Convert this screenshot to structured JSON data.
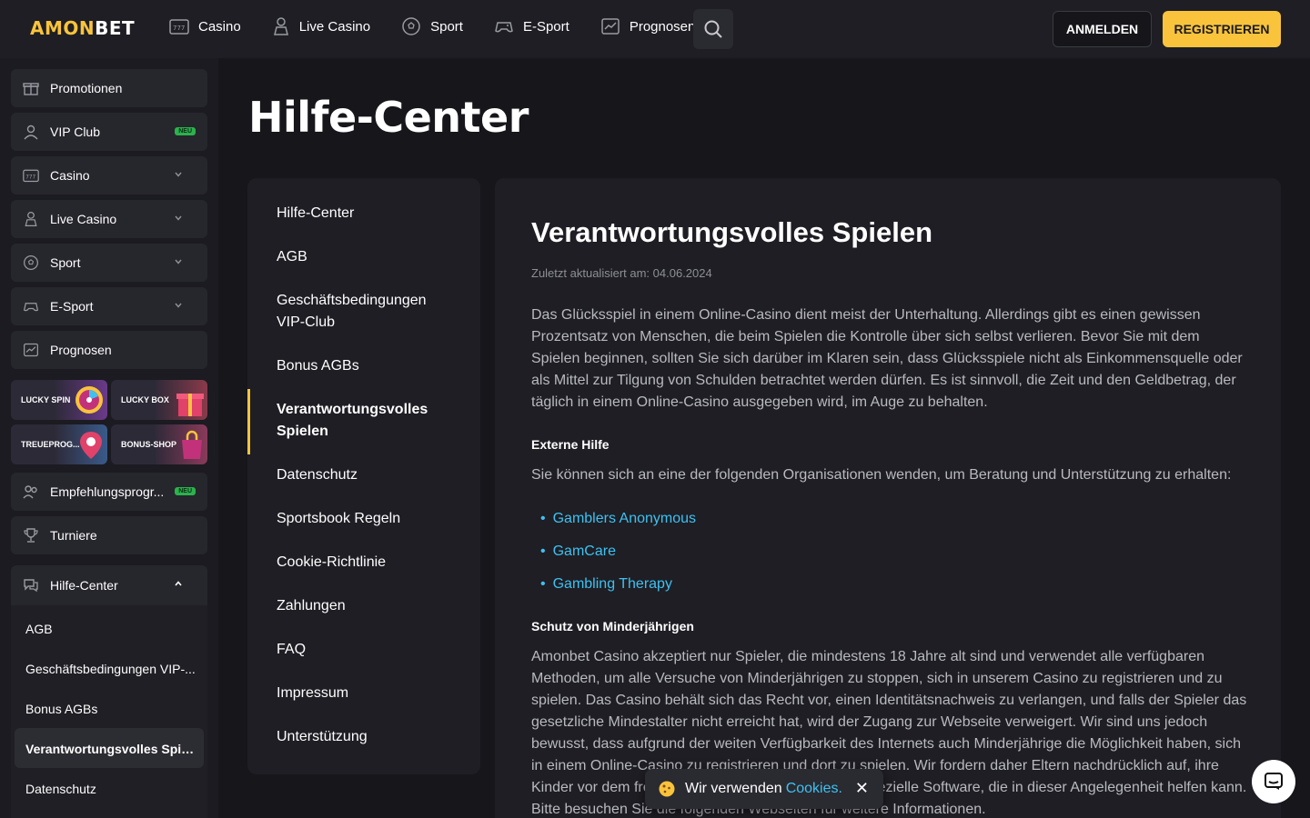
{
  "brand": {
    "part1": "AMON",
    "part2": "BET"
  },
  "header": {
    "nav": [
      "Casino",
      "Live Casino",
      "Sport",
      "E-Sport",
      "Prognosen"
    ],
    "login": "ANMELDEN",
    "register": "REGISTRIEREN"
  },
  "sidebar": {
    "items": [
      {
        "label": "Promotionen"
      },
      {
        "label": "VIP Club",
        "badge": "NEU"
      },
      {
        "label": "Casino"
      },
      {
        "label": "Live Casino"
      },
      {
        "label": "Sport"
      },
      {
        "label": "E-Sport"
      },
      {
        "label": "Prognosen"
      }
    ],
    "promos": [
      "LUCKY SPIN",
      "LUCKY BOX",
      "TREUEPROG...",
      "BONUS-SHOP"
    ],
    "referral": {
      "label": "Empfehlungsprogr...",
      "badge": "NEU"
    },
    "tournaments": "Turniere",
    "help": "Hilfe-Center",
    "help_sub": [
      "AGB",
      "Geschäftsbedingungen VIP-...",
      "Bonus AGBs",
      "Verantwortungsvolles Spiel...",
      "Datenschutz"
    ]
  },
  "main": {
    "page_title": "Hilfe-Center",
    "toc": [
      "Hilfe-Center",
      "AGB",
      "Geschäftsbedingungen VIP-Club",
      "Bonus AGBs",
      "Verantwortungsvolles Spielen",
      "Datenschutz",
      "Sportsbook Regeln",
      "Cookie-Richtlinie",
      "Zahlungen",
      "FAQ",
      "Impressum",
      "Unterstützung"
    ],
    "article": {
      "title": "Verantwortungsvolles Spielen",
      "updated": "Zuletzt aktualisiert am: 04.06.2024",
      "intro": "Das Glücksspiel in einem Online-Casino dient meist der Unterhaltung. Allerdings gibt es einen gewissen Prozentsatz von Menschen, die beim Spielen die Kontrolle über sich selbst verlieren. Bevor Sie mit dem Spielen beginnen, sollten Sie sich darüber im Klaren sein, dass Glücksspiele nicht als Einkommensquelle oder als Mittel zur Tilgung von Schulden betrachtet werden dürfen. Es ist sinnvoll, die Zeit und den Geldbetrag, der täglich in einem Online-Casino ausgegeben wird, im Auge zu behalten.",
      "h_external": "Externe Hilfe",
      "external_text": "Sie können sich an eine der folgenden Organisationen wenden, um Beratung und Unterstützung zu erhalten:",
      "links": [
        "Gamblers Anonymous",
        "GamCare",
        "Gambling Therapy"
      ],
      "h_minors": "Schutz von Minderjährigen",
      "minors_text": "Amonbet Casino akzeptiert nur Spieler, die mindestens 18 Jahre alt sind und verwendet alle verfügbaren Methoden, um alle Versuche von Minderjährigen zu stoppen, sich in unserem Casino zu registrieren und zu spielen. Das Casino behält sich das Recht vor, einen Identitätsnachweis zu verlangen, und falls der Spieler das gesetzliche Mindestalter nicht erreicht hat, wird der Zugang zur Webseite verweigert. Wir sind uns jedoch bewusst, dass aufgrund der weiten Verfügbarkeit des Internets auch Minderjährige die Möglichkeit haben, sich in einem Online-Casino zu registrieren und dort zu spielen. Wir fordern daher Eltern nachdrücklich auf, ihre Kinder vor dem freien Zugang zu schützen. Es gibt spezielle Software, die in dieser Angelegenheit helfen kann. Bitte besuchen Sie die folgenden Webseiten für weitere Informationen."
    }
  },
  "cookie": {
    "text": "Wir verwenden",
    "link": "Cookies."
  },
  "colors": {
    "accent": "#f9c33c",
    "link": "#3ec1f1",
    "badge": "#2bb24c"
  }
}
